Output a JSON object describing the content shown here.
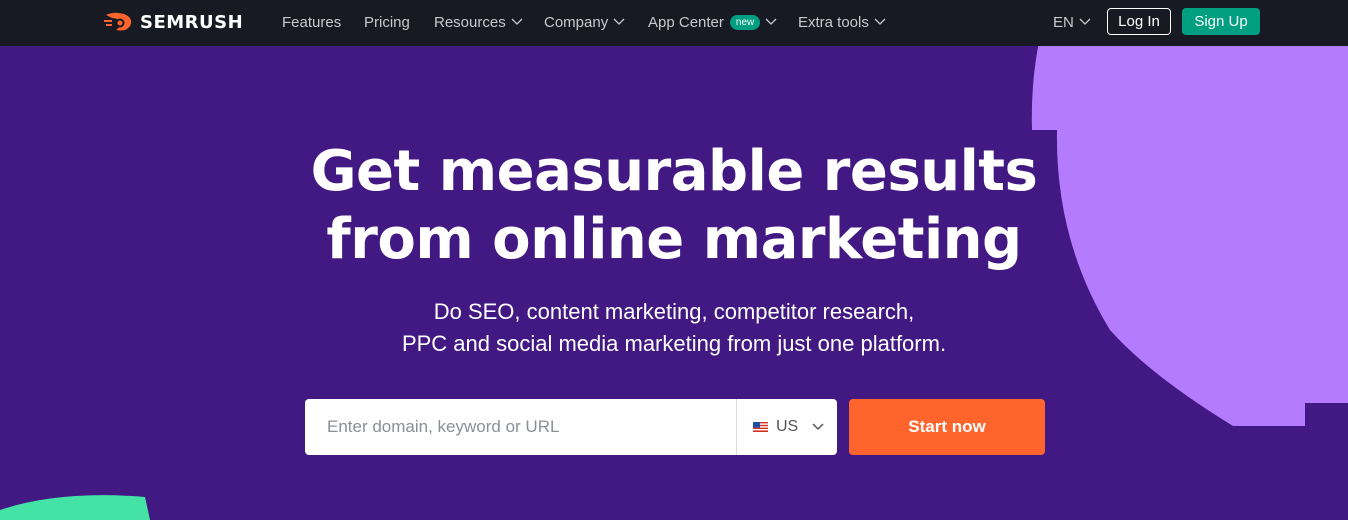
{
  "brand": {
    "name": "SEMRUSH"
  },
  "nav": {
    "items": [
      {
        "label": "Features",
        "dropdown": false
      },
      {
        "label": "Pricing",
        "dropdown": false
      },
      {
        "label": "Resources",
        "dropdown": true
      },
      {
        "label": "Company",
        "dropdown": true
      },
      {
        "label": "App Center",
        "dropdown": true,
        "badge": "new"
      },
      {
        "label": "Extra tools",
        "dropdown": true
      }
    ],
    "language": "EN",
    "login_label": "Log In",
    "signup_label": "Sign Up"
  },
  "hero": {
    "title_line1": "Get measurable results",
    "title_line2": "from online marketing",
    "subtitle_line1": "Do SEO, content marketing, competitor research,",
    "subtitle_line2": "PPC and social media marketing from just one platform."
  },
  "search": {
    "placeholder": "Enter domain, keyword or URL",
    "value": "",
    "country": "US",
    "country_flag_icon": "us-flag-icon",
    "submit_label": "Start now"
  },
  "colors": {
    "background": "#421983",
    "topbar": "#171a22",
    "accent_orange": "#ff642d",
    "accent_green": "#009f81",
    "decor_purple": "#b57bff",
    "decor_green": "#45e2a5"
  }
}
